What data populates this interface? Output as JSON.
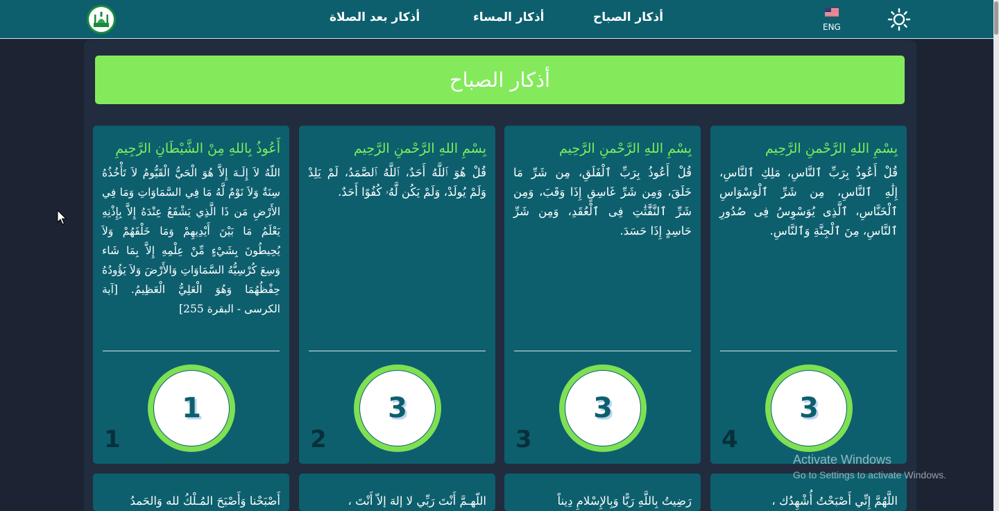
{
  "nav": {
    "links": [
      {
        "label": "أذكار الصباح"
      },
      {
        "label": "أذكار المساء"
      },
      {
        "label": "أذكار بعد الصلاة"
      }
    ],
    "language_label": "ENG",
    "flag_icon": "us-flag-icon",
    "theme_icon": "sun-icon",
    "logo_icon": "mosque-logo-icon"
  },
  "header": {
    "title": "أذكار الصباح"
  },
  "cards": [
    {
      "title": "بِسْمِ اللهِ الرَّحْمنِ الرَّحِيم",
      "text": "قُلْ أَعُوذُ بِرَبِّ ٱلنَّاسِ، مَلِكِ ٱلنَّاسِ، إِلَٰهِ ٱلنَّاسِ، مِن شَرِّ ٱلْوَسْوَاسِ ٱلْخَنَّاسِ، ٱلَّذِى يُوَسْوِسُ فِى صُدُورِ ٱلنَّاسِ، مِنَ ٱلْجِنَّةِ وَٱلنَّاسِ.",
      "count": "3",
      "index": "4"
    },
    {
      "title": "بِسْمِ اللهِ الرَّحْمنِ الرَّحِيم",
      "text": "قُلْ أَعُوذُ بِرَبِّ ٱلْفَلَقِ، مِن شَرِّ مَا خَلَقَ، وَمِن شَرِّ غَاسِقٍ إِذَا وَقَبَ، وَمِن شَرِّ ٱلنَّفَّٰثَٰتِ فِى ٱلْعُقَدِ، وَمِن شَرِّ حَاسِدٍ إِذَا حَسَدَ.",
      "count": "3",
      "index": "3"
    },
    {
      "title": "بِسْمِ اللهِ الرَّحْمنِ الرَّحِيم",
      "text": "قُلْ هُوَ ٱللَّهُ أَحَدٌ، ٱللَّهُ ٱلصَّمَدُ، لَمْ يَلِدْ وَلَمْ يُولَدْ، وَلَمْ يَكُن لَّهُۥ كُفُوًا أَحَدٌ.",
      "count": "3",
      "index": "2"
    },
    {
      "title": "أَعُوذُ بِاللهِ مِنْ الشَّيْطَانِ الرَّجِيمِ",
      "text": "اللّهُ لاَ إِلَـهَ إِلاَّ هُوَ الْحَيُّ الْقَيُّومُ لاَ تَأْخُذُهُ سِنَةٌ وَلاَ نَوْمٌ لَّهُ مَا فِي السَّمَاوَاتِ وَمَا فِي الأَرْضِ مَن ذَا الَّذِي يَشْفَعُ عِنْدَهُ إِلاَّ بِإِذْنِهِ يَعْلَمُ مَا بَيْنَ أَيْدِيهِمْ وَمَا خَلْفَهُمْ وَلاَ يُحِيطُونَ بِشَيْءٍ مِّنْ عِلْمِهِ إِلاَّ بِمَا شَاء وَسِعَ كُرْسِيُّهُ السَّمَاوَاتِ وَالأَرْضَ وَلاَ يَؤُودُهُ حِفْظُهُمَا وَهُوَ الْعَلِيُّ الْعَظِيمُ. [آية الكرسى - البقرة 255]",
      "count": "1",
      "index": "1"
    }
  ],
  "partial_cards": [
    {
      "text": "اللَّهُمَّ إِنِّي أَصْبَحْتُ أُشْهِدُك ،"
    },
    {
      "text": "رَضِيتُ بِاللَّهِ رَبًّا وَبِالإِسْلامِ دِيناً"
    },
    {
      "text": "اللّهـمَّ أَنْتَ رَبِّي لا إلهَ إلاّ أَنْتَ ،"
    },
    {
      "text": "أَصْبَحْنا وَأَصْبَحَ المُـلْكُ لله وَالحَمدُ"
    }
  ],
  "watermark": {
    "title": "Activate Windows",
    "subtitle": "Go to Settings to activate Windows."
  },
  "colors": {
    "navbar": "#0d5f6e",
    "background": "#1c2434",
    "header": "#84ea5c",
    "card": "#0d5f6e",
    "accent_green": "#7ef05a"
  }
}
